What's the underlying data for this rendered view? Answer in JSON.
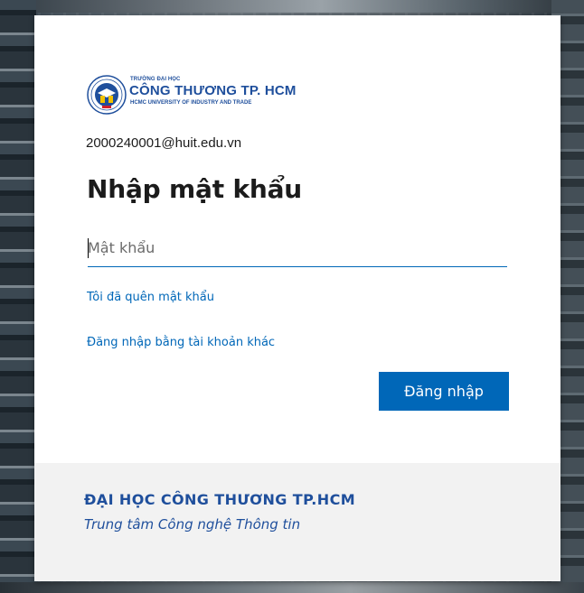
{
  "logo": {
    "line_small": "TRƯỜNG ĐẠI HỌC",
    "line_big": "CÔNG THƯƠNG TP. HCM",
    "line_sub": "HCMC UNIVERSITY OF INDUSTRY AND TRADE",
    "seal_icon": "university-seal-icon"
  },
  "email": "2000240001@huit.edu.vn",
  "title": "Nhập mật khẩu",
  "password": {
    "placeholder": "Mật khẩu",
    "value": ""
  },
  "links": {
    "forgot": "Tôi đã quên mật khẩu",
    "other_account": "Đăng nhập bằng tài khoản khác"
  },
  "buttons": {
    "sign_in": "Đăng nhập"
  },
  "footer": {
    "org": "ĐẠI HỌC CÔNG THƯƠNG TP.HCM",
    "dept": "Trung tâm Công nghệ Thông tin"
  },
  "colors": {
    "accent": "#0067b8",
    "brand": "#1f4f9c",
    "footer_bg": "#f2f2f2"
  }
}
